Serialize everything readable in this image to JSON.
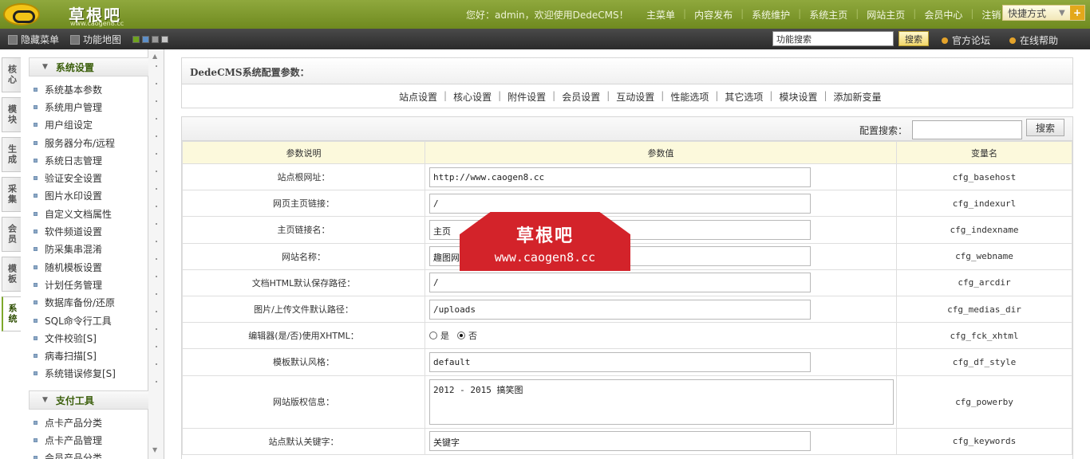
{
  "brand": {
    "logo_text": "草根吧",
    "logo_domain": "www.caogen8.cc"
  },
  "header": {
    "welcome": "您好：admin，欢迎使用DedeCMS！",
    "menu": [
      "主菜单",
      "内容发布",
      "系统维护",
      "系统主页",
      "网站主页",
      "会员中心",
      "注销"
    ],
    "quick_label": "快捷方式",
    "quick_plus": "+"
  },
  "subbar": {
    "hide_menu": "隐藏菜单",
    "func_map": "功能地图",
    "search_value": "功能搜索",
    "search_button": "搜索",
    "forum": "官方论坛",
    "help": "在线帮助",
    "skin_colors": [
      "#6fa31f",
      "#5d8fc8",
      "#9a9a9a",
      "#c7c7c7"
    ]
  },
  "vtabs": [
    {
      "label": "核心",
      "active": false
    },
    {
      "label": "模块",
      "active": false
    },
    {
      "label": "生成",
      "active": false
    },
    {
      "label": "采集",
      "active": false
    },
    {
      "label": "会员",
      "active": false
    },
    {
      "label": "模板",
      "active": false
    },
    {
      "label": "系统",
      "active": true
    }
  ],
  "sidebar": {
    "groups": [
      {
        "title": "系统设置",
        "items": [
          "系统基本参数",
          "系统用户管理",
          "用户组设定",
          "服务器分布/远程",
          "系统日志管理",
          "验证安全设置",
          "图片水印设置",
          "自定义文档属性",
          "软件频道设置",
          "防采集串混淆",
          "随机模板设置",
          "计划任务管理",
          "数据库备份/还原",
          "SQL命令行工具",
          "文件校验[S]",
          "病毒扫描[S]",
          "系统错误修复[S]"
        ]
      },
      {
        "title": "支付工具",
        "items": [
          "点卡产品分类",
          "点卡产品管理",
          "会员产品分类"
        ]
      }
    ]
  },
  "config": {
    "title": "DedeCMS系统配置参数：",
    "tabs": [
      "站点设置",
      "核心设置",
      "附件设置",
      "会员设置",
      "互动设置",
      "性能选项",
      "其它选项",
      "模块设置",
      "添加新变量"
    ],
    "search_label": "配置搜索：",
    "search_button": "搜索",
    "columns": [
      "参数说明",
      "参数值",
      "变量名"
    ],
    "rows": [
      {
        "desc": "站点根网址：",
        "value": "http://www.caogen8.cc",
        "var": "cfg_basehost",
        "kind": "text"
      },
      {
        "desc": "网页主页链接：",
        "value": "/",
        "var": "cfg_indexurl",
        "kind": "text"
      },
      {
        "desc": "主页链接名：",
        "value": "主页",
        "var": "cfg_indexname",
        "kind": "text"
      },
      {
        "desc": "网站名称：",
        "value": "趣图网",
        "var": "cfg_webname",
        "kind": "text"
      },
      {
        "desc": "文档HTML默认保存路径：",
        "value": "/",
        "var": "cfg_arcdir",
        "kind": "text"
      },
      {
        "desc": "图片/上传文件默认路径：",
        "value": "/uploads",
        "var": "cfg_medias_dir",
        "kind": "text"
      },
      {
        "desc": "编辑器(是/否)使用XHTML：",
        "value": "否",
        "var": "cfg_fck_xhtml",
        "kind": "radio",
        "options": [
          "是",
          "否"
        ]
      },
      {
        "desc": "模板默认风格：",
        "value": "default",
        "var": "cfg_df_style",
        "kind": "text"
      },
      {
        "desc": "网站版权信息：",
        "value": "2012 - 2015 搞笑图",
        "var": "cfg_powerby",
        "kind": "textarea"
      },
      {
        "desc": "站点默认关键字：",
        "value": "关键字",
        "var": "cfg_keywords",
        "kind": "text"
      }
    ]
  },
  "stamp": {
    "line1": "草根吧",
    "line2": "www.caogen8.cc"
  }
}
